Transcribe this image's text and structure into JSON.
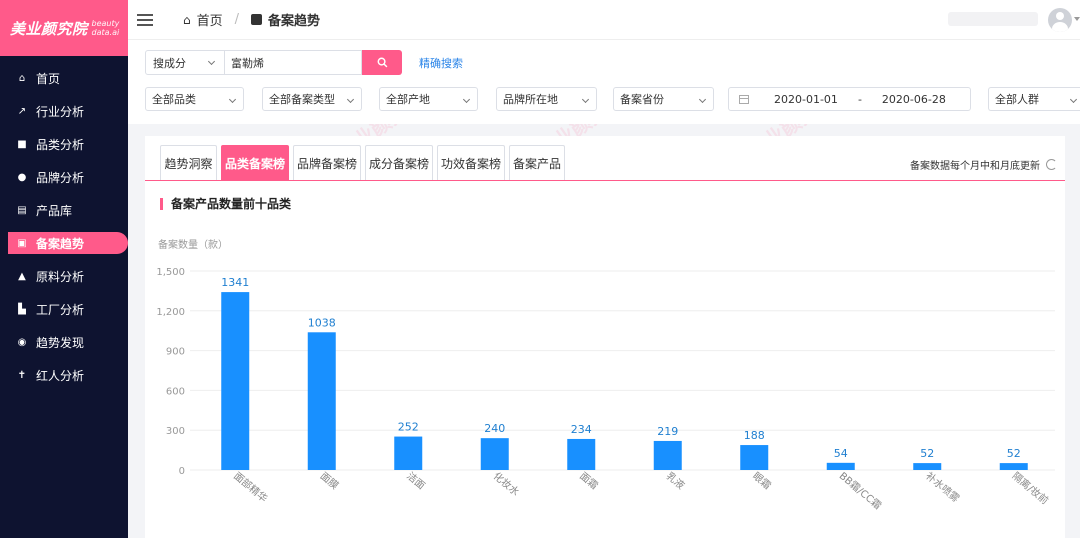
{
  "logo": {
    "text": "美业颜究院",
    "sub1": "beauty",
    "sub2": "data.ai"
  },
  "sidebar": {
    "items": [
      {
        "label": "首页",
        "icon": "home-icon"
      },
      {
        "label": "行业分析",
        "icon": "trend-line-icon"
      },
      {
        "label": "品类分析",
        "icon": "briefcase-icon"
      },
      {
        "label": "品牌分析",
        "icon": "person-icon"
      },
      {
        "label": "产品库",
        "icon": "document-icon"
      },
      {
        "label": "备案趋势",
        "icon": "chart-box-icon"
      },
      {
        "label": "原料分析",
        "icon": "flask-icon"
      },
      {
        "label": "工厂分析",
        "icon": "factory-icon"
      },
      {
        "label": "趋势发现",
        "icon": "compass-icon"
      },
      {
        "label": "红人分析",
        "icon": "influencer-icon"
      }
    ]
  },
  "breadcrumb": {
    "home": "首页",
    "current": "备案趋势"
  },
  "search": {
    "type": "搜成分",
    "value": "富勒烯",
    "advanced": "精确搜索"
  },
  "filters": [
    "全部品类",
    "全部备案类型",
    "全部产地",
    "品牌所在地",
    "备案省份",
    "全部人群"
  ],
  "date_range": {
    "start": "2020-01-01",
    "sep": "-",
    "end": "2020-06-28"
  },
  "tabs": [
    "趋势洞察",
    "品类备案榜",
    "品牌备案榜",
    "成分备案榜",
    "功效备案榜",
    "备案产品"
  ],
  "active_tab": 1,
  "update_note": "备案数据每个月中和月底更新",
  "section_title": "备案产品数量前十品类",
  "chart_data": {
    "type": "bar",
    "title": "备案产品数量前十品类",
    "ylabel": "备案数量（款）",
    "xlabel": "",
    "categories": [
      "面部精华",
      "面膜",
      "洁面",
      "化妆水",
      "面霜",
      "乳液",
      "眼霜",
      "BB霜/CC霜",
      "补水喷雾",
      "隔离/妆前"
    ],
    "values": [
      1341,
      1038,
      252,
      240,
      234,
      219,
      188,
      54,
      52,
      52
    ],
    "yticks": [
      "0",
      "300",
      "600",
      "900",
      "1,200",
      "1,500"
    ],
    "ylim": [
      0,
      1500
    ],
    "grid": true,
    "color": "#1890ff"
  },
  "colors": {
    "accent": "#ff5a8a",
    "sidebar_bg": "#0e1330",
    "bar": "#1890ff",
    "link": "#2a84e8"
  }
}
